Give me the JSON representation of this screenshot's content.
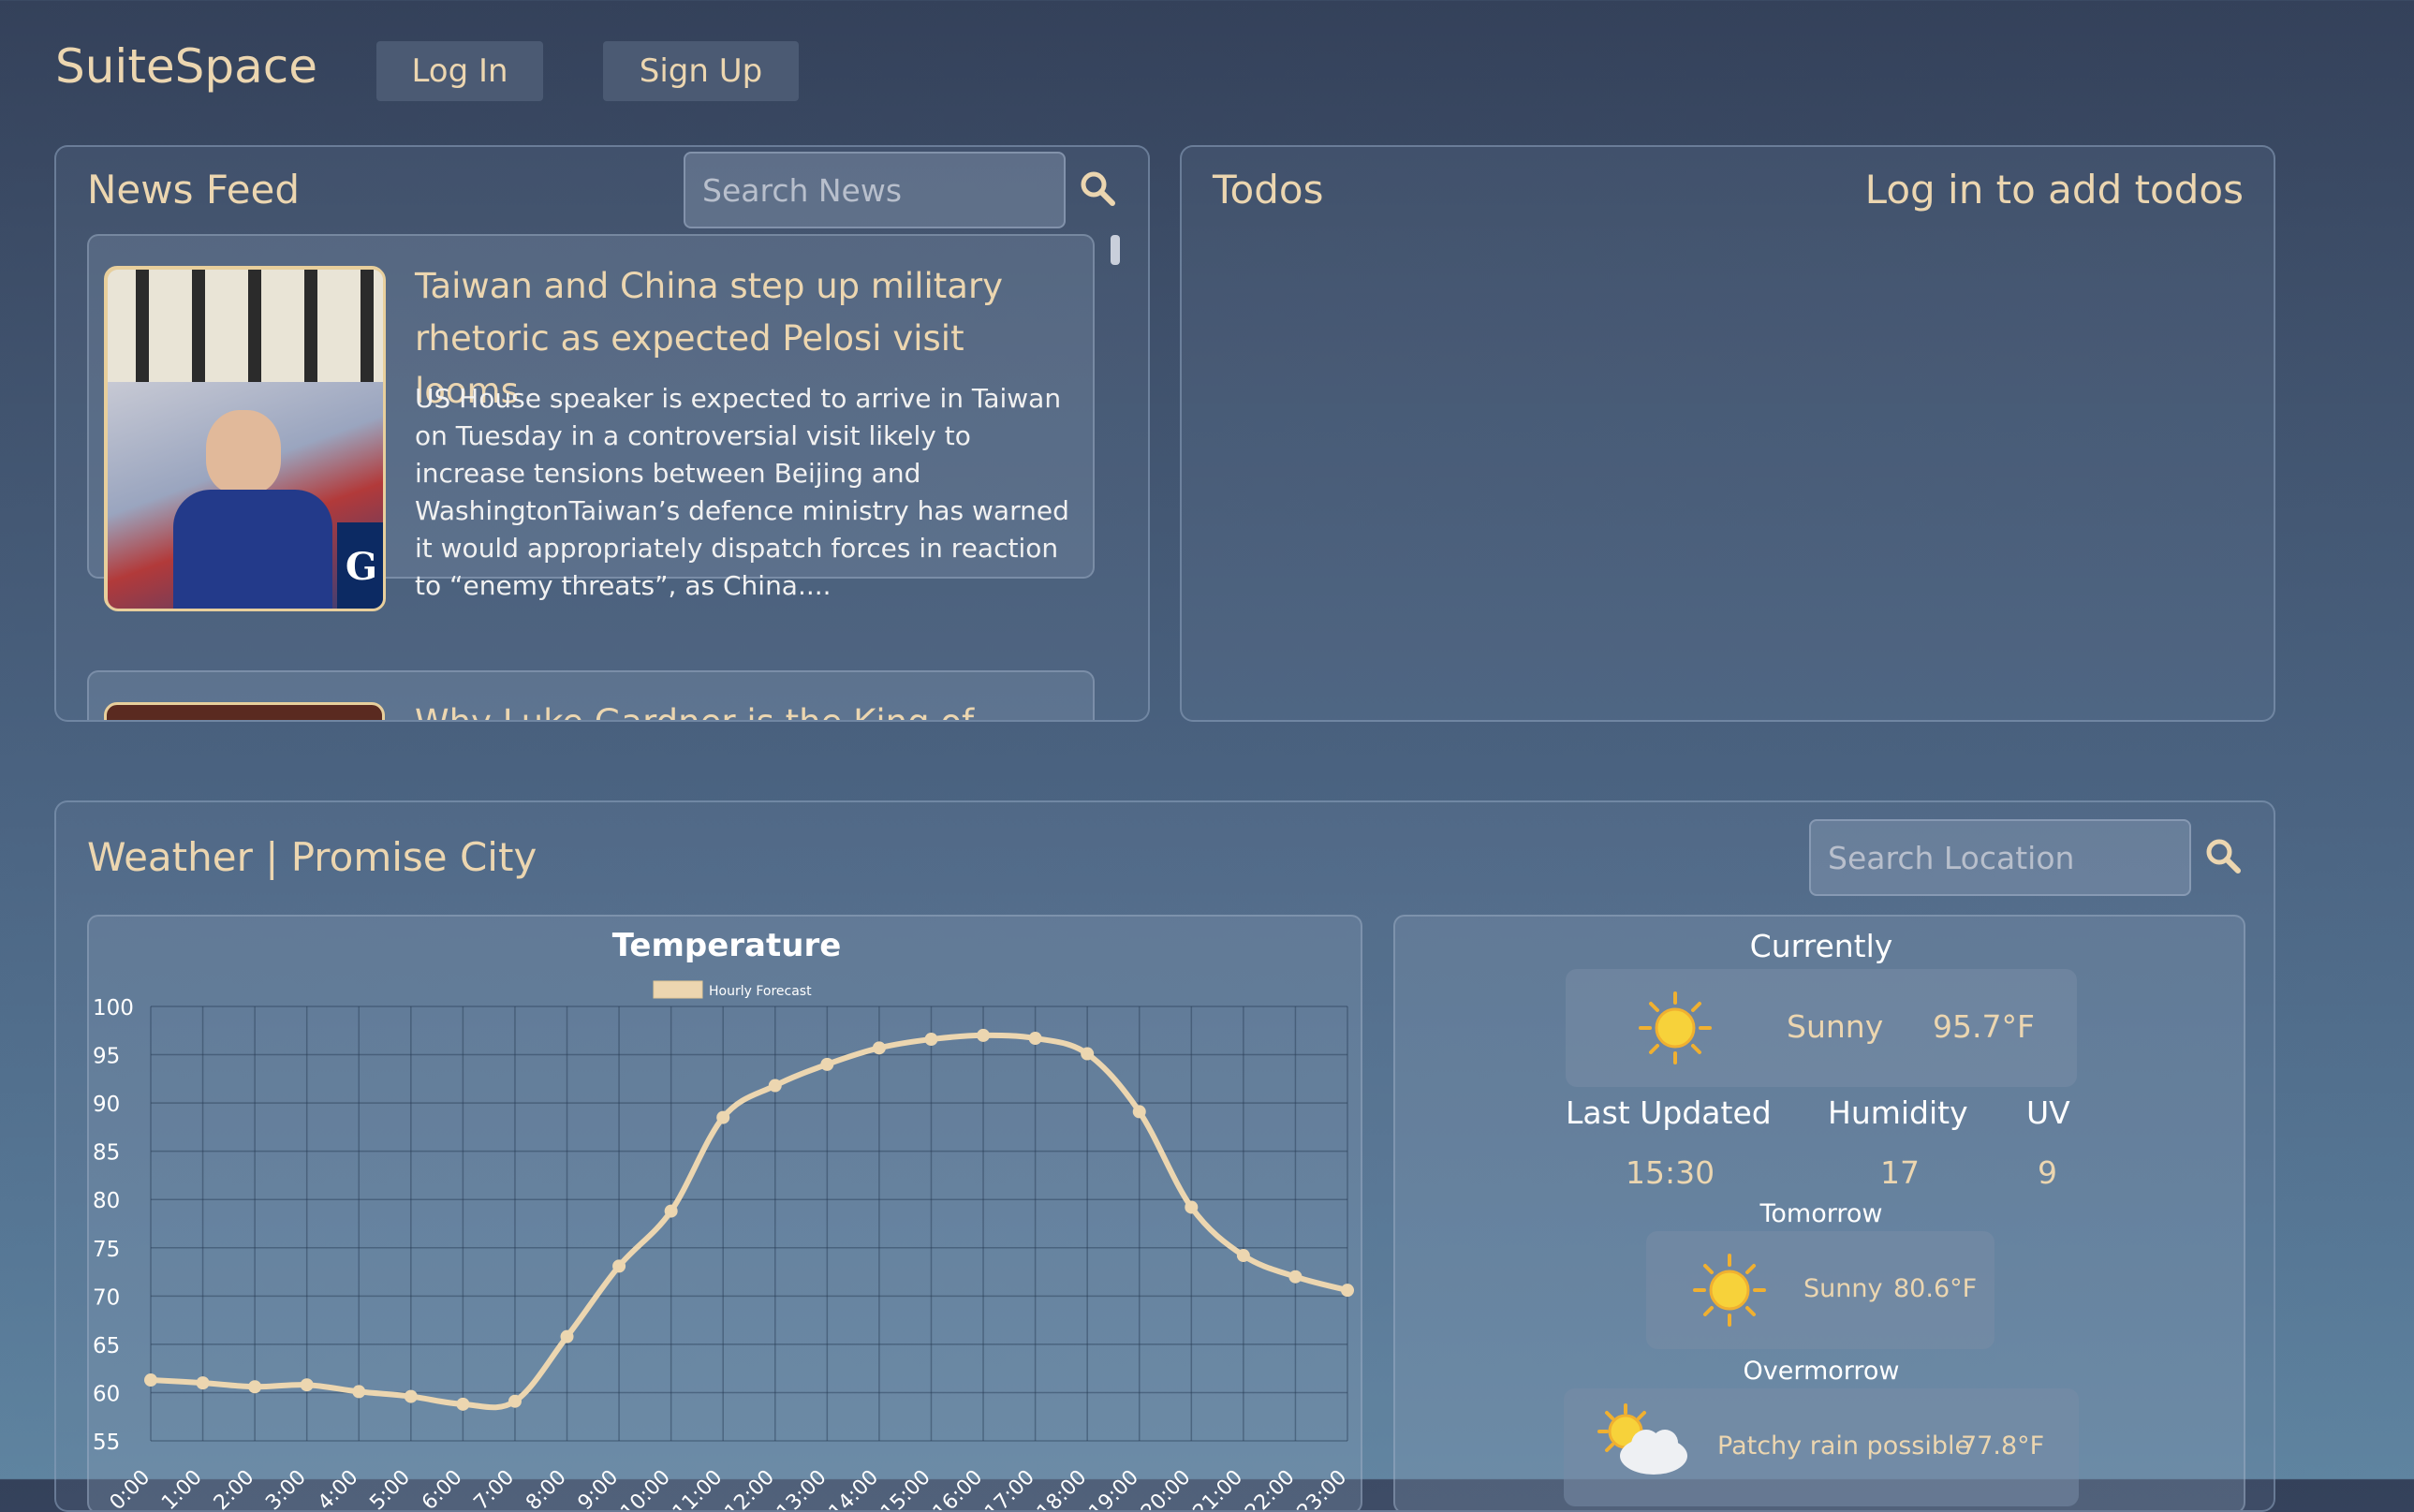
{
  "header": {
    "brand": "SuiteSpace",
    "login_label": "Log In",
    "signup_label": "Sign Up"
  },
  "news": {
    "title": "News Feed",
    "search_placeholder": "Search News",
    "articles": [
      {
        "title": "Taiwan and China step up military rhetoric as expected Pelosi visit looms",
        "description": "US House speaker is expected to arrive in Taiwan on Tuesday in a controversial visit likely to increase tensions between Beijing and WashingtonTaiwan’s defence ministry has warned it would appropriately dispatch forces in reaction to “enemy threats”, as China....",
        "thumb_badge": "G"
      },
      {
        "title": "Why Luke Gardner is the King of...",
        "description": ""
      }
    ]
  },
  "todos": {
    "title": "Todos",
    "prompt": "Log in to add todos"
  },
  "weather": {
    "title": "Weather | Promise City",
    "search_placeholder": "Search Location",
    "current": {
      "heading": "Currently",
      "condition": "Sunny",
      "temp": "95.7°F",
      "icon": "sun-icon",
      "last_updated_label": "Last Updated",
      "humidity_label": "Humidity",
      "uv_label": "UV",
      "last_updated": "15:30",
      "humidity": "17",
      "uv": "9"
    },
    "tomorrow": {
      "heading": "Tomorrow",
      "condition": "Sunny",
      "temp": "80.6°F",
      "icon": "sun-icon"
    },
    "overmorrow": {
      "heading": "Overmorrow",
      "condition": "Patchy rain possible",
      "temp": "77.8°F",
      "icon": "sun-cloud-icon"
    }
  },
  "colors": {
    "accent": "#ecd6b0",
    "background_top": "#34415a",
    "background_bottom": "#5f84a0"
  },
  "chart_data": {
    "type": "line",
    "title": "Temperature",
    "legend": "Hourly Forecast",
    "legend_position": "top-center",
    "grid": true,
    "ylim": [
      55,
      100
    ],
    "yticks": [
      100,
      95,
      90,
      85,
      80,
      75,
      70,
      65,
      60,
      55
    ],
    "x": [
      "0:00",
      "1:00",
      "2:00",
      "3:00",
      "4:00",
      "5:00",
      "6:00",
      "7:00",
      "8:00",
      "9:00",
      "10:00",
      "11:00",
      "12:00",
      "13:00",
      "14:00",
      "15:00",
      "16:00",
      "17:00",
      "18:00",
      "19:00",
      "20:00",
      "21:00",
      "22:00",
      "23:00"
    ],
    "series": [
      {
        "name": "Hourly Forecast",
        "values": [
          61.3,
          61.0,
          60.6,
          60.8,
          60.1,
          59.6,
          58.8,
          59.1,
          65.8,
          73.1,
          78.8,
          88.5,
          91.8,
          94.0,
          95.7,
          96.6,
          97.0,
          96.7,
          95.1,
          89.1,
          79.2,
          74.2,
          72.0,
          70.6
        ]
      }
    ]
  }
}
